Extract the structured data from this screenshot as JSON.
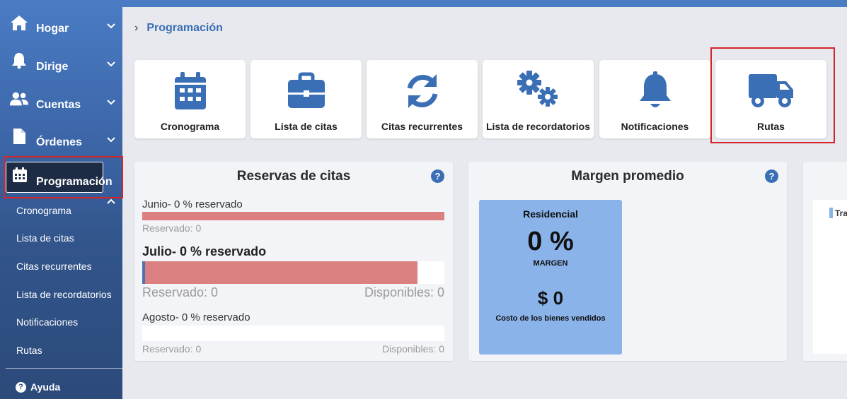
{
  "sidebar": {
    "items": [
      {
        "label": "Hogar",
        "icon": "home-icon"
      },
      {
        "label": "Dirige",
        "icon": "bell-icon"
      },
      {
        "label": "Cuentas",
        "icon": "users-icon"
      },
      {
        "label": "Órdenes",
        "icon": "file-icon"
      }
    ],
    "active": {
      "label": "Programación",
      "icon": "calendar-icon"
    },
    "sub_items": [
      "Cronograma",
      "Lista de citas",
      "Citas recurrentes",
      "Lista de recordatorios",
      "Notificaciones",
      "Rutas"
    ],
    "help_label": "Ayuda"
  },
  "breadcrumb": {
    "current": "Programación"
  },
  "tiles": [
    {
      "label": "Cronograma",
      "icon": "calendar-icon"
    },
    {
      "label": "Lista de citas",
      "icon": "briefcase-icon"
    },
    {
      "label": "Citas recurrentes",
      "icon": "sync-icon"
    },
    {
      "label": "Lista de recordatorios",
      "icon": "gears-icon"
    },
    {
      "label": "Notificaciones",
      "icon": "bell-icon"
    },
    {
      "label": "Rutas",
      "icon": "truck-icon"
    }
  ],
  "reservations": {
    "title": "Reservas de citas",
    "months": [
      {
        "title": "Junio- 0 % reservado",
        "reserved": "Reservado: 0",
        "available": "",
        "fill_fraction": 1.0
      },
      {
        "title": "Julio- 0 % reservado",
        "reserved": "Reservado: 0",
        "available": "Disponibles: 0",
        "fill_fraction": 0.91
      },
      {
        "title": "Agosto- 0 % reservado",
        "reserved": "Reservado: 0",
        "available": "Disponibles: 0",
        "fill_fraction": 0
      }
    ]
  },
  "margin": {
    "title": "Margen promedio",
    "card": {
      "title": "Residencial",
      "percent": "0 %",
      "percent_label": "MARGEN",
      "amount": "$ 0",
      "amount_label": "Costo de los bienes vendidos"
    }
  },
  "third_panel": {
    "legend_text": "Tra"
  },
  "colors": {
    "accent": "#3a6fb5",
    "sidebar": "#3c66a8",
    "highlight": "#d4252a",
    "bar_fill": "#db7f80",
    "card": "#8ab3ea"
  }
}
